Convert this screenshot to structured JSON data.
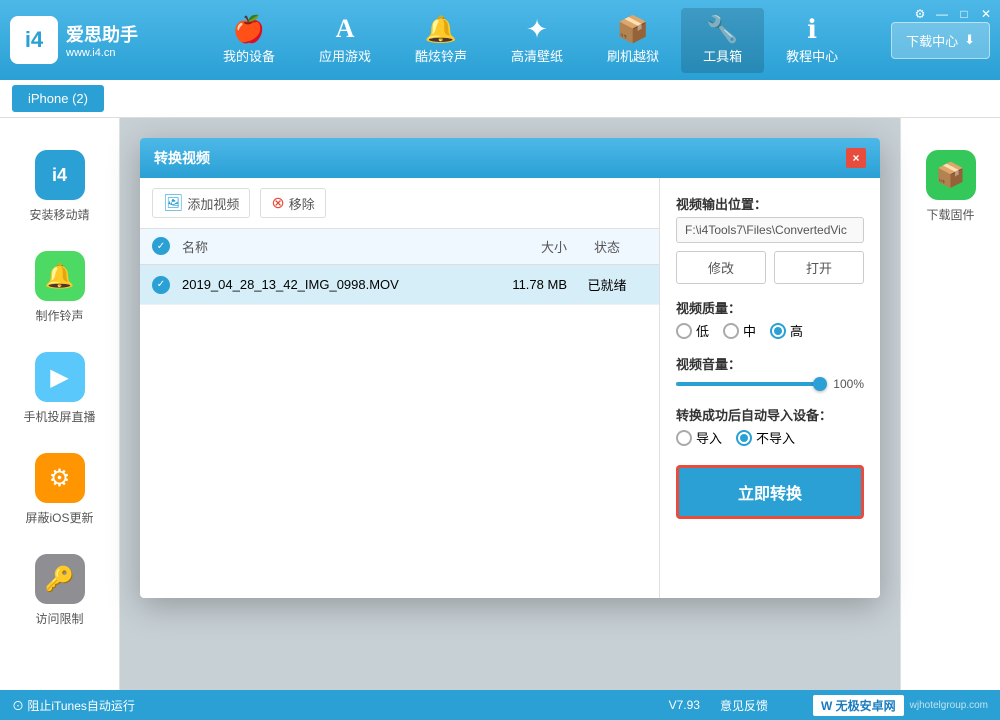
{
  "app": {
    "logo_text": "爱思助手",
    "logo_sub": "www.i4.cn",
    "logo_letter": "i4"
  },
  "nav": {
    "items": [
      {
        "id": "my-device",
        "label": "我的设备",
        "icon": "🍎"
      },
      {
        "id": "app-games",
        "label": "应用游戏",
        "icon": "🅰"
      },
      {
        "id": "ringtones",
        "label": "酷炫铃声",
        "icon": "🔔"
      },
      {
        "id": "wallpaper",
        "label": "高清壁纸",
        "icon": "⚙"
      },
      {
        "id": "jailbreak",
        "label": "刷机越狱",
        "icon": "📦"
      },
      {
        "id": "toolbox",
        "label": "工具箱",
        "icon": "🔧",
        "active": true
      },
      {
        "id": "tutorials",
        "label": "教程中心",
        "icon": "ℹ"
      }
    ],
    "download_btn": "下载中心"
  },
  "subnav": {
    "device_label": "iPhone (2)"
  },
  "sidebar": {
    "items": [
      {
        "id": "install-mobile",
        "label": "安装移动靖",
        "icon": "i4",
        "color": "blue"
      },
      {
        "id": "make-ringtone",
        "label": "制作铃声",
        "icon": "🔔",
        "color": "green"
      },
      {
        "id": "mirror",
        "label": "手机投屏直播",
        "icon": "▶",
        "color": "teal"
      },
      {
        "id": "block-ios",
        "label": "屏蔽iOS更新",
        "icon": "⚙",
        "color": "orange"
      },
      {
        "id": "access-limit",
        "label": "访问限制",
        "icon": "🔑",
        "color": "gray"
      }
    ]
  },
  "right_panel": {
    "items": [
      {
        "id": "download-firmware",
        "label": "下载固件",
        "icon": "📦",
        "color": "green"
      }
    ]
  },
  "modal": {
    "title": "转换视频",
    "close_label": "×",
    "toolbar": {
      "add_label": "添加视频",
      "remove_label": "移除"
    },
    "table": {
      "headers": [
        "名称",
        "大小",
        "状态"
      ],
      "rows": [
        {
          "name": "2019_04_28_13_42_IMG_0998.MOV",
          "size": "11.78 MB",
          "status": "已就绪",
          "checked": true
        }
      ]
    },
    "settings": {
      "output_label": "视频输出位置：",
      "output_path": "F:\\i4Tools7\\Files\\ConvertedVic",
      "modify_btn": "修改",
      "open_btn": "打开",
      "quality_label": "视频质量：",
      "quality_options": [
        {
          "label": "低",
          "checked": false
        },
        {
          "label": "中",
          "checked": false
        },
        {
          "label": "高",
          "checked": true
        }
      ],
      "volume_label": "视频音量：",
      "volume_value": "100%",
      "volume_percent": 100,
      "import_label": "转换成功后自动导入设备：",
      "import_options": [
        {
          "label": "导入",
          "checked": false
        },
        {
          "label": "不导入",
          "checked": true
        }
      ],
      "convert_btn": "立即转换"
    }
  },
  "statusbar": {
    "left_label": "⊙ 阻止iTunes自动运行",
    "version": "V7.93",
    "feedback": "意见反馈"
  },
  "watermark": {
    "brand": "W 无极安卓网",
    "url": "wjhotelgroup.com"
  }
}
